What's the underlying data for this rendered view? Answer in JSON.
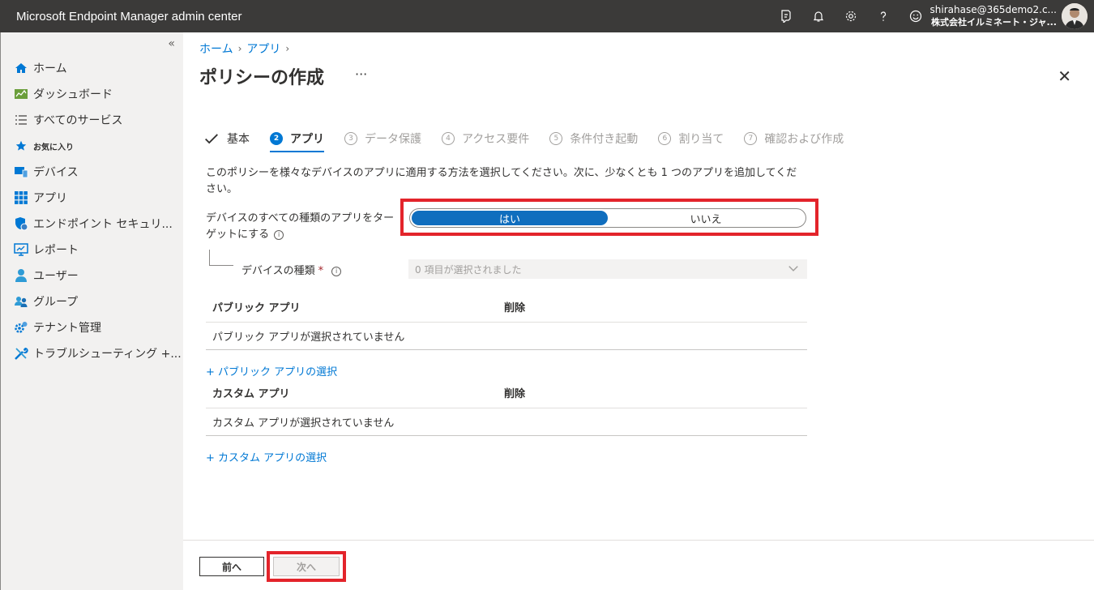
{
  "header": {
    "app_title": "Microsoft Endpoint Manager admin center",
    "account_email": "shirahase@365demo2.c...",
    "account_org": "株式会社イルミネート・ジャ...",
    "icons": [
      "feedback-icon",
      "bell-icon",
      "gear-icon",
      "help-icon",
      "smiley-icon"
    ]
  },
  "sidebar": {
    "collapse_glyph": "«",
    "items": [
      {
        "label": "ホーム",
        "icon": "home-icon"
      },
      {
        "label": "ダッシュボード",
        "icon": "dashboard-icon"
      },
      {
        "label": "すべてのサービス",
        "icon": "list-icon"
      },
      {
        "label": "お気に入り",
        "icon": "star-icon"
      },
      {
        "label": "デバイス",
        "icon": "device-icon"
      },
      {
        "label": "アプリ",
        "icon": "apps-icon"
      },
      {
        "label": "エンドポイント セキュリ...",
        "icon": "shield-icon"
      },
      {
        "label": "レポート",
        "icon": "report-icon"
      },
      {
        "label": "ユーザー",
        "icon": "user-icon"
      },
      {
        "label": "グループ",
        "icon": "group-icon"
      },
      {
        "label": "テナント管理",
        "icon": "tenant-icon"
      },
      {
        "label": "トラブルシューティング +...",
        "icon": "wrench-icon"
      }
    ]
  },
  "breadcrumb": {
    "home": "ホーム",
    "apps": "アプリ"
  },
  "page": {
    "title": "ポリシーの作成",
    "more": "···",
    "close": "✕"
  },
  "steps": [
    {
      "num": "✓",
      "label": "基本",
      "state": "done"
    },
    {
      "num": "2",
      "label": "アプリ",
      "state": "active"
    },
    {
      "num": "3",
      "label": "データ保護",
      "state": "pending"
    },
    {
      "num": "4",
      "label": "アクセス要件",
      "state": "pending"
    },
    {
      "num": "5",
      "label": "条件付き起動",
      "state": "pending"
    },
    {
      "num": "6",
      "label": "割り当て",
      "state": "pending"
    },
    {
      "num": "7",
      "label": "確認および作成",
      "state": "pending"
    }
  ],
  "form": {
    "description": "このポリシーを様々なデバイスのアプリに適用する方法を選択してください。次に、少なくとも 1 つのアプリを追加してください。",
    "target_label": "デバイスのすべての種類のアプリをターゲットにする",
    "toggle_yes": "はい",
    "toggle_no": "いいえ",
    "toggle_selected": "はい",
    "device_type_label": "デバイスの種類",
    "required_mark": "*",
    "device_type_value": "0 項目が選択されました"
  },
  "public_apps": {
    "col_name": "パブリック アプリ",
    "col_delete": "削除",
    "empty": "パブリック アプリが選択されていません",
    "add_link": "+ パブリック アプリの選択"
  },
  "custom_apps": {
    "col_name": "カスタム アプリ",
    "col_delete": "削除",
    "empty": "カスタム アプリが選択されていません",
    "add_link": "+ カスタム アプリの選択"
  },
  "footer": {
    "prev": "前へ",
    "next": "次へ"
  },
  "colors": {
    "topbar": "#3b3a39",
    "accent": "#0078d4",
    "highlight": "#e3242b"
  }
}
